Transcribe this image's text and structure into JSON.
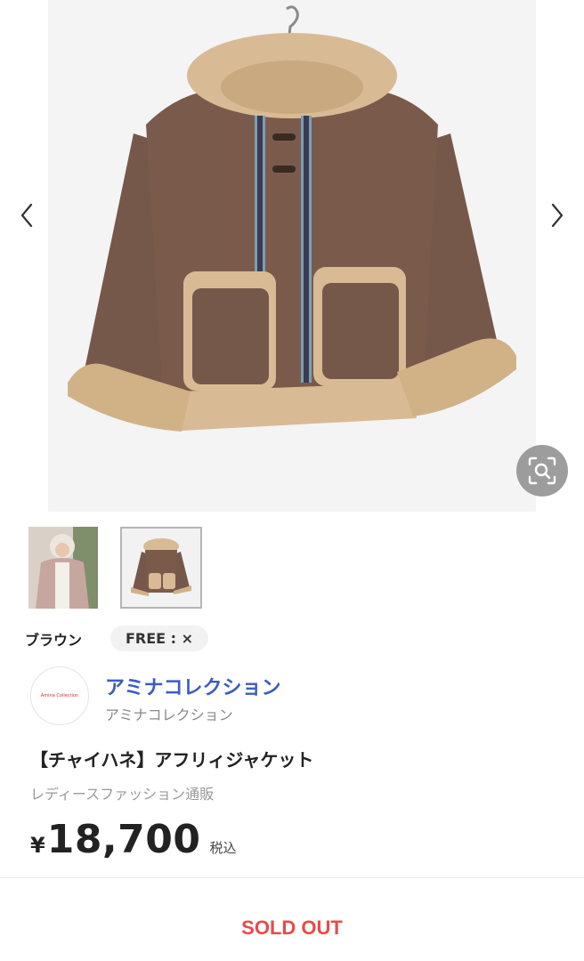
{
  "gallery": {
    "prev_icon": "chevron-left-icon",
    "next_icon": "chevron-right-icon",
    "lens_icon": "visual-search-icon",
    "main_image": "brown suede hooded jacket with beige faux-fur trim",
    "thumbnails": [
      {
        "image": "model wearing pink hooded jacket"
      },
      {
        "image": "brown hooded jacket",
        "selected": true
      }
    ]
  },
  "variant": {
    "color_label": "ブラウン",
    "size_chip": "FREE : ×"
  },
  "shop": {
    "logo_text": "Amina Collection",
    "name": "アミナコレクション",
    "subname": "アミナコレクション"
  },
  "product": {
    "title": "【チャイハネ】アフリィジャケット",
    "category": "レディースファッション通販",
    "currency": "¥",
    "price": "18,700",
    "tax_label": "税込"
  },
  "action": {
    "status": "SOLD OUT"
  },
  "colors": {
    "shop_link": "#3d5dbf",
    "sold_out": "#e84a4a",
    "jacket_brown": "#76584a",
    "fur_beige": "#d8bb95"
  }
}
